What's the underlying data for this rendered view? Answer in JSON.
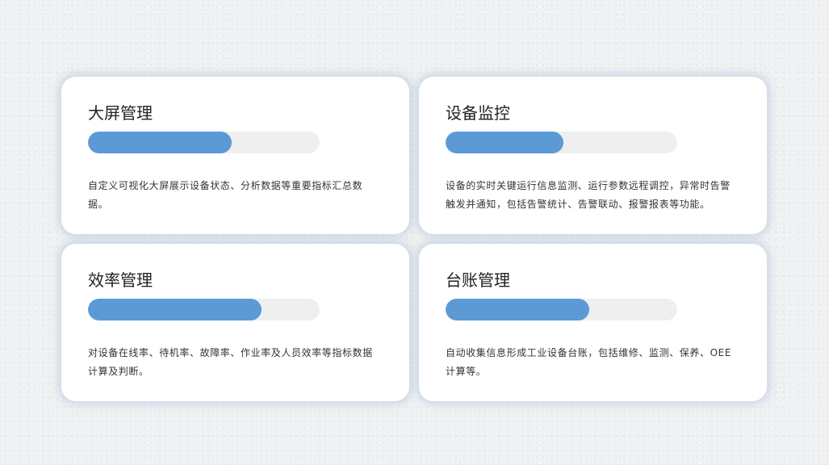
{
  "cards": [
    {
      "title": "大屏管理",
      "progress": 0.62,
      "description": "自定义可视化大屏展示设备状态、分析数据等重要指标汇总数据。"
    },
    {
      "title": "设备监控",
      "progress": 0.51,
      "description": "设备的实时关键运行信息监测、运行参数远程调控，异常时告警触发并通知，包括告警统计、告警联动、报警报表等功能。"
    },
    {
      "title": "效率管理",
      "progress": 0.75,
      "description": "对设备在线率、待机率、故障率、作业率及人员效率等指标数据计算及判断。"
    },
    {
      "title": "台账管理",
      "progress": 0.62,
      "description": "自动收集信息形成工业设备台账，包括维修、监测、保养、OEE计算等。"
    }
  ],
  "colors": {
    "accent": "#5b9ad5",
    "track": "#efefef",
    "card_bg": "#ffffff"
  }
}
